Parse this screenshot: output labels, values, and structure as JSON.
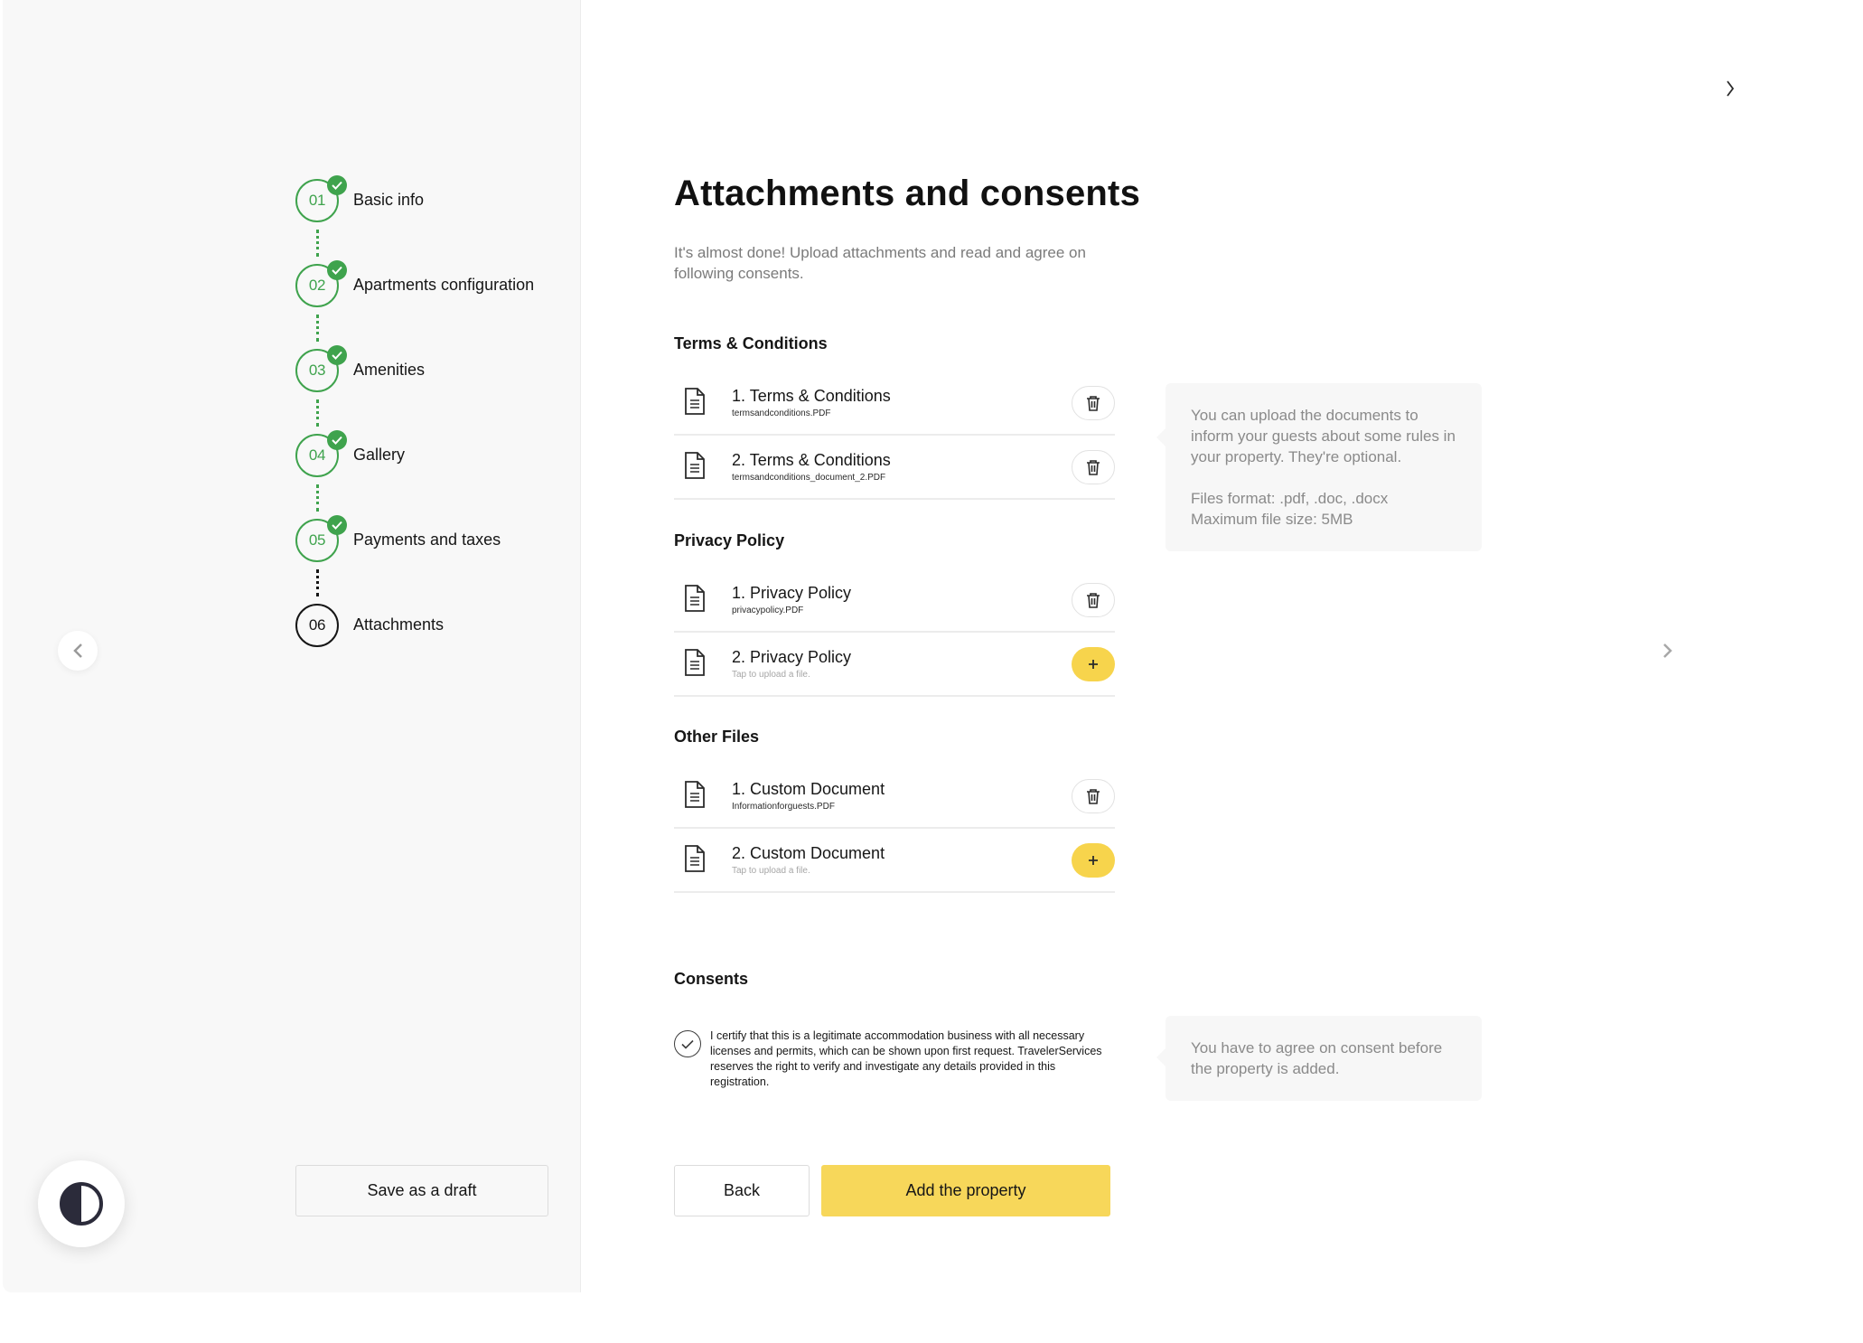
{
  "stepper": {
    "steps": [
      {
        "number": "01",
        "label": "Basic info",
        "status": "completed"
      },
      {
        "number": "02",
        "label": "Apartments configuration",
        "status": "completed"
      },
      {
        "number": "03",
        "label": "Amenities",
        "status": "completed"
      },
      {
        "number": "04",
        "label": "Gallery",
        "status": "completed"
      },
      {
        "number": "05",
        "label": "Payments and taxes",
        "status": "completed"
      },
      {
        "number": "06",
        "label": "Attachments",
        "status": "current"
      }
    ],
    "save_draft_label": "Save as a draft"
  },
  "main": {
    "title": "Attachments and consents",
    "subtitle": "It's almost done! Upload attachments and read and agree on following consents."
  },
  "sections": [
    {
      "title": "Terms & Conditions",
      "files": [
        {
          "name": "1. Terms & Conditions",
          "sub": "termsandconditions.PDF",
          "action": "delete"
        },
        {
          "name": "2. Terms & Conditions",
          "sub": "termsandconditions_document_2.PDF",
          "action": "delete"
        }
      ]
    },
    {
      "title": "Privacy Policy",
      "files": [
        {
          "name": "1. Privacy Policy",
          "sub": "privacypolicy.PDF",
          "action": "delete"
        },
        {
          "name": "2. Privacy Policy",
          "sub": "Tap to upload a file.",
          "action": "add"
        }
      ]
    },
    {
      "title": "Other Files",
      "files": [
        {
          "name": "1. Custom Document",
          "sub": "Informationforguests.PDF",
          "action": "delete"
        },
        {
          "name": "2. Custom Document",
          "sub": "Tap to upload a file.",
          "action": "add"
        }
      ]
    }
  ],
  "consents": {
    "title": "Consents",
    "text": "I certify that this is a legitimate accommodation business with all necessary licenses and permits, which can be shown upon first request. TravelerServices reserves the right to verify and investigate any details provided in this registration.",
    "checked": true
  },
  "buttons": {
    "back": "Back",
    "add_property": "Add the property"
  },
  "info": {
    "upload_line1": "You can upload the documents to inform your guests about some rules in your property. They're optional.",
    "upload_formats": "Files format: .pdf, .doc, .docx",
    "upload_max_size": "Maximum file size: 5MB",
    "consent": "You have to agree on consent before the property is added."
  },
  "colors": {
    "accent_yellow": "#f7d75a",
    "success_green": "#3fa34d",
    "text_dark": "#161616",
    "text_muted": "#7b7b7b"
  },
  "icons": {
    "file": "document-icon",
    "delete": "trash-icon",
    "add": "plus-icon",
    "check": "check-icon",
    "theme": "contrast-icon"
  }
}
